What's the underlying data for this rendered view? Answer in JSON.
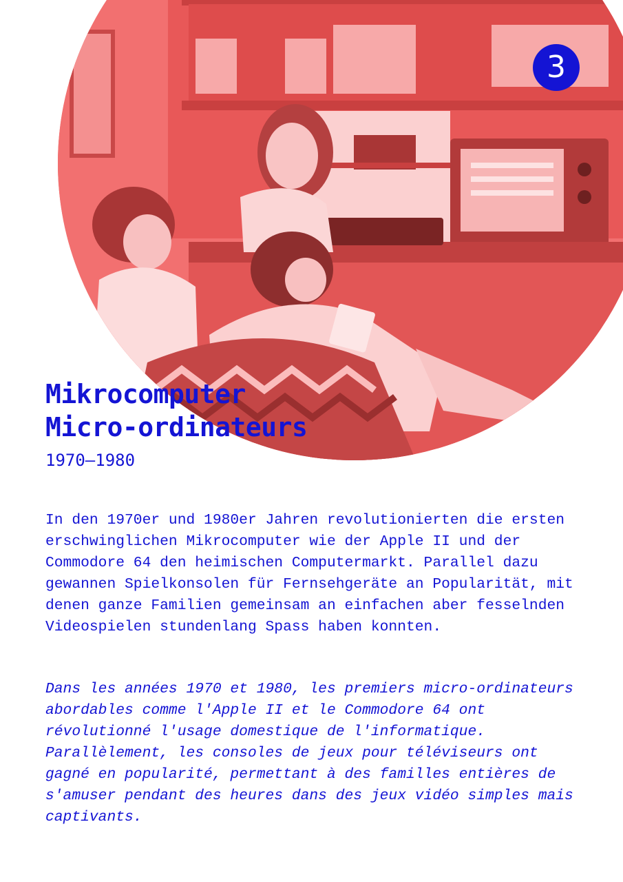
{
  "badge": {
    "number": "3"
  },
  "title": {
    "line_de": "Mikrocomputer",
    "line_fr": "Micro-ordinateurs"
  },
  "period": "1970–1980",
  "body": {
    "de": "In den 1970er und 1980er Jahren revolutionierten die ersten erschwinglichen Mikrocomputer wie der Apple II und der Commodore 64 den heimischen Computermarkt. Parallel dazu gewannen Spielkonsolen für Fernsehgeräte an Popularität, mit denen ganze Familien gemeinsam an einfachen aber fesselnden Videospielen stundenlang Spass haben konnten.",
    "fr": "Dans les années 1970 et 1980, les premiers micro-ordinateurs abordables comme l'Apple II et le Commodore 64 ont révolutionné l'usage domestique de l'informatique. Parallèlement, les consoles de jeux pour téléviseurs ont gagné en popularité, permettant à des familles entières de s'amuser pendant des heures dans des jeux vidéo simples mais captivants."
  },
  "colors": {
    "accent": "#1414d4",
    "photo_tint": "#f27070",
    "background": "#ffffff"
  }
}
